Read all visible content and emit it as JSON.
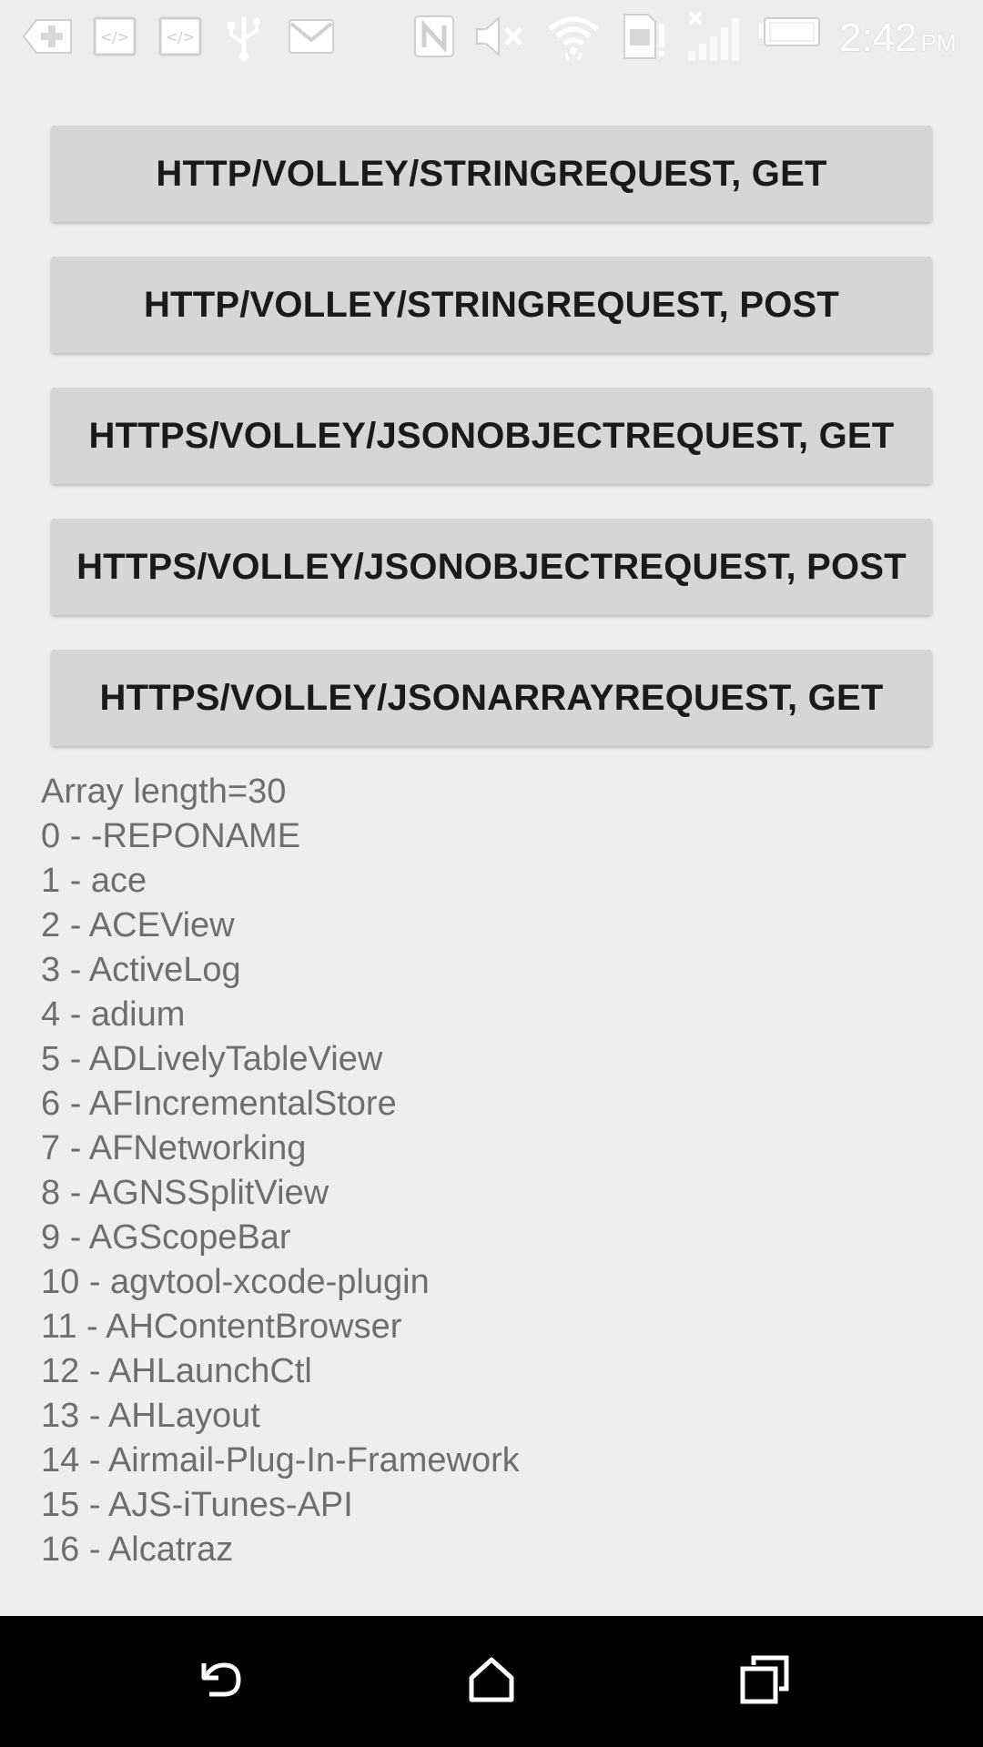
{
  "status_bar": {
    "icons": [
      "add-notification-icon",
      "code-icon",
      "code-icon",
      "usb-icon",
      "mail-icon",
      "nfc-icon",
      "mute-icon",
      "wifi-icon",
      "sd-card-alert-icon",
      "no-signal-icon",
      "battery-icon"
    ],
    "time": "2:42",
    "ampm": "PM"
  },
  "buttons": [
    {
      "label": "HTTP/VOLLEY/STRINGREQUEST, GET"
    },
    {
      "label": "HTTP/VOLLEY/STRINGREQUEST, POST"
    },
    {
      "label": "HTTPS/VOLLEY/JSONOBJECTREQUEST, GET"
    },
    {
      "label": "HTTPS/VOLLEY/JSONOBJECTREQUEST, POST"
    },
    {
      "label": "HTTPS/VOLLEY/JSONARRAYREQUEST, GET"
    }
  ],
  "results": {
    "header": "Array length=30",
    "items": [
      "0 - -REPONAME",
      "1 - ace",
      "2 - ACEView",
      "3 - ActiveLog",
      "4 - adium",
      "5 - ADLivelyTableView",
      "6 - AFIncrementalStore",
      "7 - AFNetworking",
      "8 - AGNSSplitView",
      "9 - AGScopeBar",
      "10 - agvtool-xcode-plugin",
      "11 - AHContentBrowser",
      "12 - AHLaunchCtl",
      "13 - AHLayout",
      "14 - Airmail-Plug-In-Framework",
      "15 - AJS-iTunes-API",
      "16 - Alcatraz"
    ]
  },
  "nav_bar": {
    "icons": [
      "back-icon",
      "home-icon",
      "recents-icon"
    ]
  },
  "colors": {
    "background": "#eeeeee",
    "button": "#d6d6d6",
    "button_text": "#1a1a1a",
    "result_text": "#6e6e6e",
    "status_icons": "#ffffff",
    "nav_bar": "#000000"
  }
}
